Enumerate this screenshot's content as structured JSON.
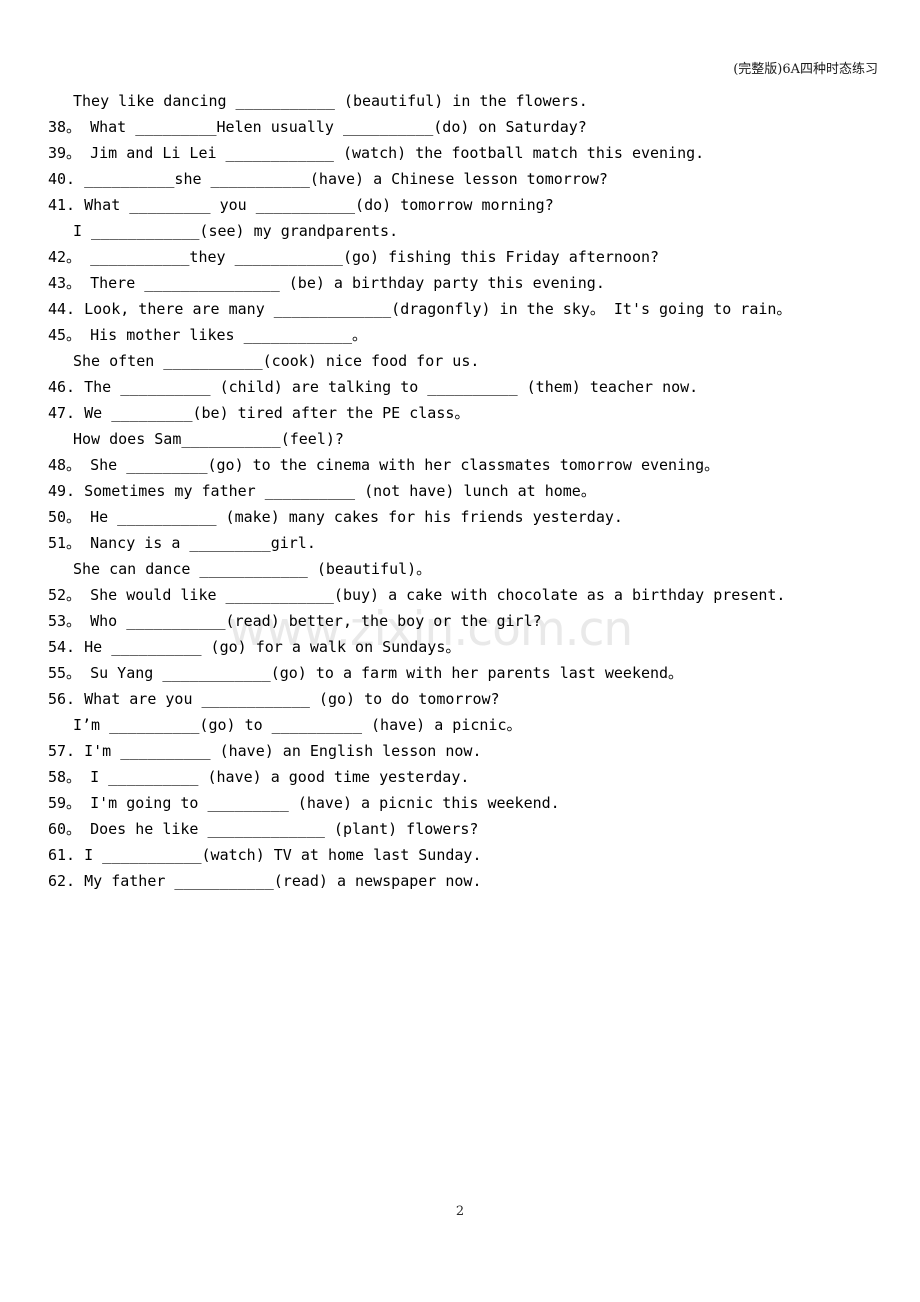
{
  "header": {
    "running_head": "(完整版)6A四种时态练习"
  },
  "watermark": {
    "text": "www.zixin.com.cn",
    "color": "#e9e9e9"
  },
  "footer": {
    "page_number": "2"
  },
  "colors": {
    "page_background": "#ffffff",
    "text": "#000000",
    "header_text": "#1a1a1a",
    "watermark": "#e9e9e9"
  },
  "exercise": {
    "lines": [
      {
        "kind": "orphan",
        "text": "They like dancing ___________ (beautiful) in the flowers."
      },
      {
        "kind": "item",
        "text": "38。 What _________Helen usually __________(do) on Saturday?"
      },
      {
        "kind": "item",
        "text": "39。 Jim and Li Lei ____________ (watch) the football match this evening."
      },
      {
        "kind": "item",
        "text": "40. __________she ___________(have) a Chinese lesson tomorrow?"
      },
      {
        "kind": "item",
        "text": "41. What _________ you ___________(do) tomorrow morning?"
      },
      {
        "kind": "cont",
        "text": "I ____________(see) my grandparents."
      },
      {
        "kind": "item",
        "text": "42。 ___________they ____________(go) fishing this Friday afternoon?"
      },
      {
        "kind": "item",
        "text": "43。 There _______________ (be) a birthday party this evening."
      },
      {
        "kind": "item",
        "text": "44. Look, there are many _____________(dragonfly) in the sky。 It's going to rain。"
      },
      {
        "kind": "item",
        "text": "45。 His mother likes ____________。"
      },
      {
        "kind": "cont",
        "text": "She often ___________(cook) nice food for us."
      },
      {
        "kind": "item",
        "text": "46. The __________ (child) are talking to __________ (them) teacher now."
      },
      {
        "kind": "item",
        "text": "47. We _________(be) tired after the PE class。"
      },
      {
        "kind": "cont",
        "text": "How does Sam___________(feel)?"
      },
      {
        "kind": "item",
        "text": "48。 She _________(go) to the cinema with her classmates tomorrow evening。"
      },
      {
        "kind": "item",
        "text": "49. Sometimes my father __________ (not have) lunch at home。"
      },
      {
        "kind": "item",
        "text": "50。 He ___________ (make) many cakes for his friends yesterday."
      },
      {
        "kind": "item",
        "text": "51。 Nancy is a _________girl."
      },
      {
        "kind": "cont",
        "text": "She can dance ____________ (beautiful)。"
      },
      {
        "kind": "item",
        "text": "52。 She would like ____________(buy) a cake with chocolate as a birthday present."
      },
      {
        "kind": "item",
        "text": "53。 Who ___________(read) better, the boy or the girl?"
      },
      {
        "kind": "item",
        "text": "54. He __________ (go) for a walk on Sundays。"
      },
      {
        "kind": "item",
        "text": "55。 Su Yang ____________(go) to a farm with her parents last weekend。"
      },
      {
        "kind": "item",
        "text": "56. What are you ____________ (go) to do tomorrow?"
      },
      {
        "kind": "cont",
        "text": "I’m __________(go) to __________ (have) a picnic。"
      },
      {
        "kind": "item",
        "text": "57. I'm __________ (have) an English lesson now."
      },
      {
        "kind": "item",
        "text": "58。 I __________ (have) a good time yesterday."
      },
      {
        "kind": "item",
        "text": "59。 I'm going to _________ (have) a picnic this weekend."
      },
      {
        "kind": "item",
        "text": "60。 Does he like _____________ (plant) flowers?"
      },
      {
        "kind": "item",
        "text": "61. I ___________(watch) TV at home last Sunday."
      },
      {
        "kind": "item",
        "text": "62. My father ___________(read) a newspaper now."
      }
    ]
  }
}
